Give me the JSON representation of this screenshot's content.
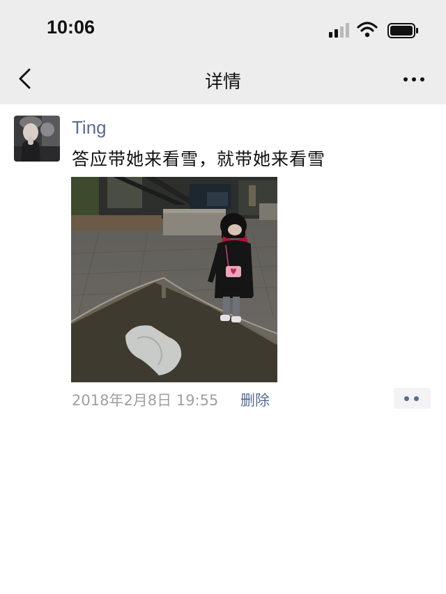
{
  "status_bar": {
    "time": "10:06",
    "icons": [
      "signal-icon",
      "wifi-icon",
      "battery-icon"
    ]
  },
  "nav": {
    "back_icon": "chevron-left-icon",
    "title": "详情",
    "more_icon": "more-dots-icon"
  },
  "post": {
    "author": "Ting",
    "text": "答应带她来看雪，就带她来看雪",
    "timestamp": "2018年2月8日 19:55",
    "delete_label": "删除",
    "comment_icon": "comment-dots-icon"
  },
  "colors": {
    "header_bg": "#ededed",
    "link": "#576b95",
    "meta": "#a0a0a0"
  }
}
